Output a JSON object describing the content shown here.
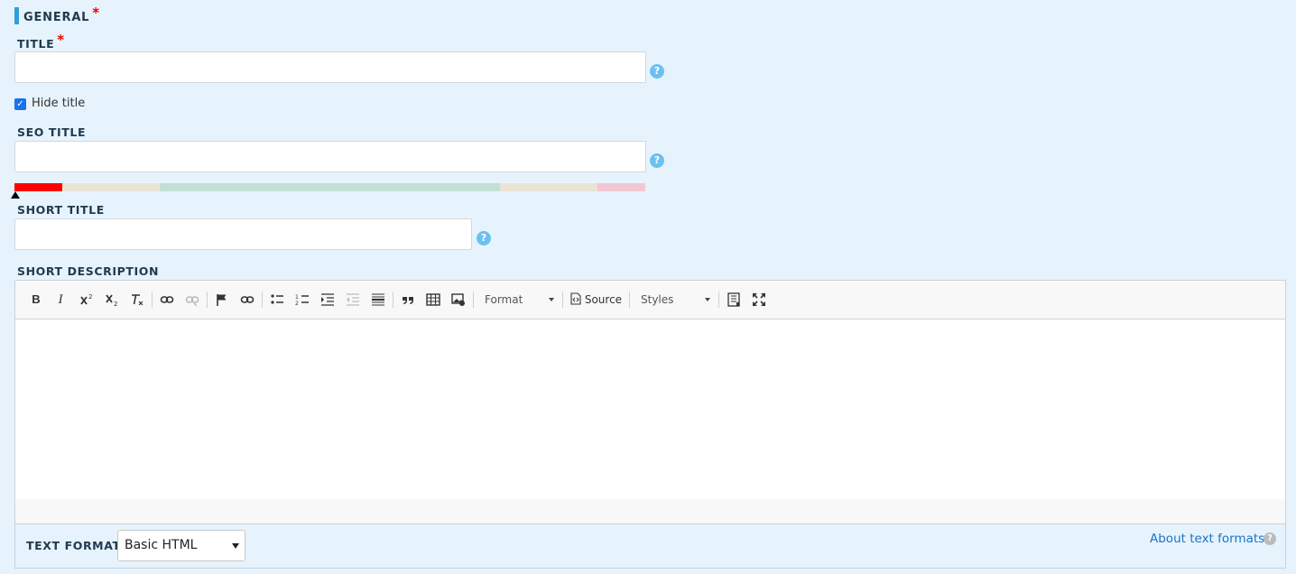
{
  "section": {
    "legend": "GENERAL",
    "required_mark": "*"
  },
  "title_field": {
    "label": "TITLE",
    "required_mark": "*",
    "value": "",
    "help": "?"
  },
  "hide_title": {
    "label": "Hide title",
    "checked": true
  },
  "seo_title": {
    "label": "SEO TITLE",
    "value": "",
    "help": "?",
    "meter_colors": [
      "#ff0000",
      "#ebe4d6",
      "#c2e0d5",
      "#ebe4d6",
      "#f1c8d2"
    ]
  },
  "short_title": {
    "label": "SHORT TITLE",
    "value": "",
    "help": "?"
  },
  "short_description": {
    "label": "SHORT DESCRIPTION",
    "toolbar": {
      "bold": "B",
      "italic": "I",
      "format_label": "Format",
      "source_label": "Source",
      "styles_label": "Styles"
    }
  },
  "text_format": {
    "label": "TEXT FORMAT",
    "selected": "Basic HTML",
    "about_link": "About text formats",
    "help": "?"
  }
}
